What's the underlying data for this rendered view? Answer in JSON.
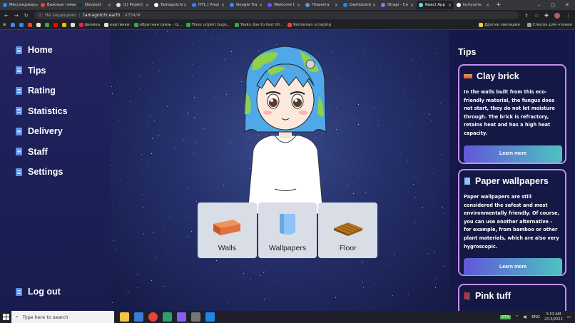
{
  "browser": {
    "tabs": [
      {
        "label": "Мессенджер",
        "color": "#2d88ff"
      },
      {
        "label": "Важные темы",
        "color": "#ff3b30"
      },
      {
        "label": "Devpost",
        "color": "#003e54"
      },
      {
        "label": "(2) Project",
        "color": "#e0e0e0"
      },
      {
        "label": "Tamagotchi",
        "color": "#ffffff"
      },
      {
        "label": "HTL | Prezi",
        "color": "#3181ff"
      },
      {
        "label": "Google Tra",
        "color": "#4285f4"
      },
      {
        "label": "Welcome t",
        "color": "#7c4dff"
      },
      {
        "label": "Планета",
        "color": "#5a9bd8"
      },
      {
        "label": "Dashboard",
        "color": "#1e88e5"
      },
      {
        "label": "Strapi - Co",
        "color": "#8e75ff"
      },
      {
        "label": "React App",
        "color": "#61dafb"
      },
      {
        "label": "kuriyume",
        "color": "#ffffff"
      }
    ],
    "insecure_label": "Не защищено",
    "url_host": "tamagotchi.earth",
    "url_rest": ":4334/#",
    "bookmarks": [
      {
        "label": "",
        "color": "#4285f4"
      },
      {
        "label": "",
        "color": "#2d88ff"
      },
      {
        "label": "",
        "color": "#ea4335"
      },
      {
        "label": "",
        "color": "#e0e0e0"
      },
      {
        "label": "",
        "color": "#34a853"
      },
      {
        "label": "",
        "color": "#ff0000"
      },
      {
        "label": "",
        "color": "#fbbc04"
      },
      {
        "label": "",
        "color": "#e0e0e0"
      },
      {
        "label": "физика",
        "color": "#e91e63"
      },
      {
        "label": "картинки",
        "color": "#e0e0e0"
      },
      {
        "label": "обратная связь - G...",
        "color": "#34a853"
      },
      {
        "label": "Fixes urgent bugs...",
        "color": "#34a853"
      },
      {
        "label": "Tasks due to test till...",
        "color": "#34a853"
      },
      {
        "label": "Romanian scraping",
        "color": "#ea4335"
      }
    ],
    "other_bookmarks": "Другие закладки",
    "reading_list": "Список для чтения"
  },
  "sidebar": {
    "items": [
      {
        "label": "Home"
      },
      {
        "label": "Tips"
      },
      {
        "label": "Rating"
      },
      {
        "label": "Statistics"
      },
      {
        "label": "Delivery"
      },
      {
        "label": "Staff"
      },
      {
        "label": "Settings"
      }
    ],
    "logout": "Log out"
  },
  "stage": {
    "items": [
      {
        "label": "Walls"
      },
      {
        "label": "Wallpapers"
      },
      {
        "label": "Floor"
      }
    ]
  },
  "tips": {
    "title": "Tips",
    "cards": [
      {
        "title": "Clay brick",
        "icon": "brick-icon",
        "body": "In the walls built from this eco-friendly material, the fungus does not start, they do not let moisture through. The brick is refractory, retains heat and has a high heat capacity.",
        "button": "Learn more"
      },
      {
        "title": "Paper wallpapers",
        "icon": "paper-icon",
        "body": "Paper wallpapers are still considered the safest and most environmentally friendly. Of course, you can use another alternative - for example, from bamboo or other plant materials, which are also very hygroscopic.",
        "button": "Learn more"
      },
      {
        "title": "Pink tuff",
        "icon": "tuff-icon",
        "body": "",
        "button": ""
      }
    ]
  },
  "taskbar": {
    "search_placeholder": "Type here to search",
    "battery": "57%",
    "lang": "ENG",
    "time": "5:53 AM",
    "date": "2/13/2022"
  }
}
